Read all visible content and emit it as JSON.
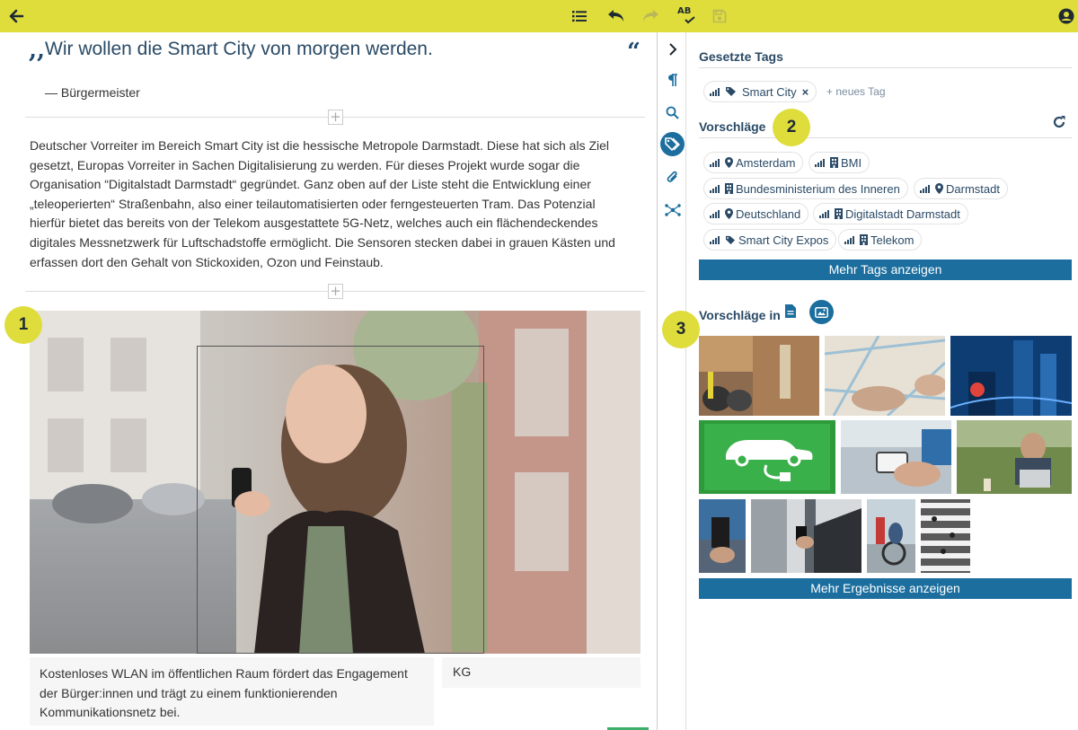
{
  "toolbar": {
    "back_icon": "arrow-left-icon",
    "list_icon": "list-icon",
    "undo_icon": "undo-icon",
    "redo_icon": "redo-icon",
    "spellcheck_label": "AB",
    "save_icon": "save-icon",
    "user_icon": "account-icon",
    "bar_color": "#dfdd3c"
  },
  "editor": {
    "quote_open": ",,",
    "quote_text": "Wir wollen die Smart City von morgen werden.",
    "quote_close": "“",
    "quote_author": "— Bürgermeister",
    "plus_symbol": "+",
    "paragraph": "Deutscher Vorreiter im Bereich Smart City ist die hessische Metropole Darmstadt. Diese hat sich als Ziel gesetzt, Europas Vorreiter in Sachen Digitalisierung zu werden. Für dieses Projekt wurde sogar die Organisation “Digitalstadt Darmstadt“ gegründet. Ganz oben auf der Liste steht die Entwicklung einer „teleoperierten“ Straßenbahn, also einer teilautomatisierten oder ferngesteuerten Tram. Das Potenzial hierfür bietet das bereits von der Telekom ausgestattete 5G-Netz, welches auch ein flächendeckendes digitales Messnetzwerk für Luftschadstoffe ermöglicht. Die Sensoren stecken dabei in grauen Kästen und erfassen dort den Gehalt von Stickoxiden, Ozon und Feinstaub.",
    "image_caption": "Kostenloses WLAN im öffentlichen Raum fördert das Engagement der Bürger:innen und trägt zu einem funktionierenden Kommunikationsnetz bei.",
    "image_credit": "KG"
  },
  "toolstrip": {
    "items": [
      "chevron-right-icon",
      "paragraph-icon",
      "search-icon",
      "tag-icon",
      "paperclip-icon",
      "network-icon"
    ],
    "active": "tag-icon"
  },
  "panel": {
    "set_tags_title": "Gesetzte Tags",
    "set_tags": [
      {
        "label": "Smart City",
        "type": "tag"
      }
    ],
    "new_tag_label": "+ neues Tag",
    "suggestions_title": "Vorschläge",
    "suggestion_chips": [
      {
        "label": "Amsterdam",
        "type": "location"
      },
      {
        "label": "BMI",
        "type": "organization"
      },
      {
        "label": "Bundesministerium des Inneren",
        "type": "organization"
      },
      {
        "label": "Darmstadt",
        "type": "location"
      },
      {
        "label": "Deutschland",
        "type": "location"
      },
      {
        "label": "Digitalstadt Darmstadt",
        "type": "organization"
      },
      {
        "label": "Smart City Expos",
        "type": "tag"
      },
      {
        "label": "Telekom",
        "type": "organization"
      }
    ],
    "more_tags_button": "Mehr Tags anzeigen",
    "suggestions_in_title": "Vorschläge in",
    "more_results_button": "Mehr Ergebnisse anzeigen",
    "accent": "#1b6e9e"
  },
  "badges": [
    "1",
    "2",
    "3"
  ]
}
